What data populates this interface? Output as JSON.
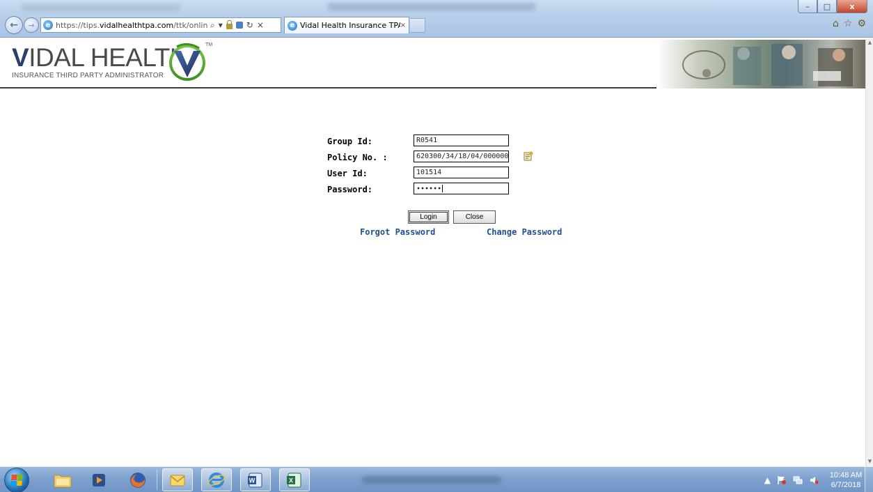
{
  "browser": {
    "address_prefix": "https://tips.",
    "address_domain": "vidalhealthtpa.com",
    "address_suffix": "/ttk/onlineacc",
    "tab_title": "Vidal Health Insurance TPA ...",
    "tab_close": "×",
    "window_buttons": {
      "minimize": "–",
      "maximize": "□",
      "close": "x"
    },
    "nav_back": "←",
    "nav_forward": "→",
    "search_glyph": "⌕",
    "dropdown_glyph": "▾",
    "refresh_glyph": "↻",
    "stop_glyph": "×",
    "home_glyph": "⌂",
    "favorites_glyph": "☆",
    "tools_glyph": "⚙"
  },
  "header": {
    "logo_letter": "V",
    "logo_name": "IDAL HEALTH",
    "logo_tagline": "INSURANCE THIRD PARTY ADMINISTRATOR",
    "logo_tm": "TM",
    "brand_color": "#2b3f6e",
    "logo_green": "#5fae2f"
  },
  "form": {
    "group_id": {
      "label": "Group Id:",
      "value": "R0541"
    },
    "policy_no": {
      "label": "Policy No. :",
      "value": "620300/34/18/04/000000"
    },
    "user_id": {
      "label": "User Id:",
      "value": "101514"
    },
    "password": {
      "label": "Password:",
      "value": "••••••"
    },
    "login_label": "Login",
    "close_label": "Close",
    "forgot_password": "Forgot Password",
    "change_password": "Change Password",
    "link_color": "#1d4f95"
  },
  "taskbar": {
    "time": "10:48 AM",
    "date": "6/7/2018"
  },
  "scrollbar": {
    "up": "▲",
    "down": "▼"
  }
}
